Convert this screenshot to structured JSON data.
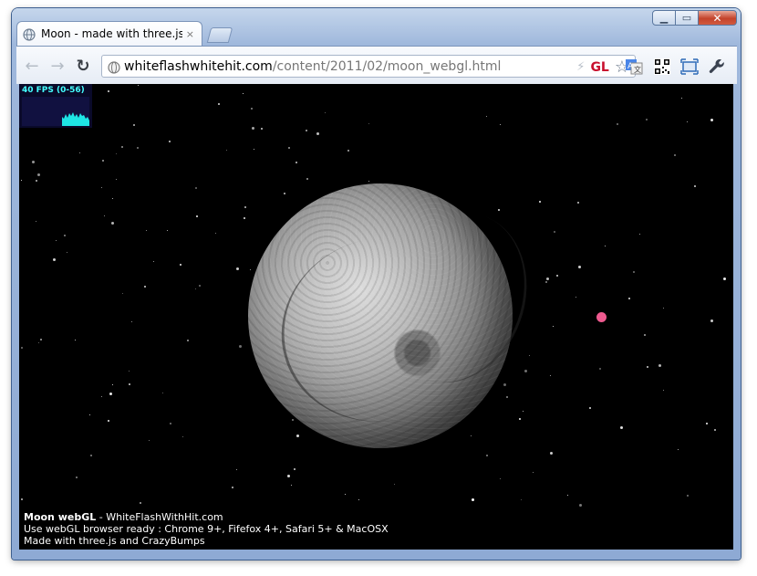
{
  "browser": {
    "tab_title": "Moon - made with three.js",
    "tab_close": "×",
    "url_host": "whiteflashwhitehit.com",
    "url_path": "/content/2011/02/moon_webgl.html",
    "gl_badge": "GL",
    "back_glyph": "←",
    "forward_glyph": "→",
    "reload_glyph": "↻",
    "star_glyph": "☆",
    "bolt_glyph": "⚡",
    "wrench_glyph": "🔧",
    "minimize_glyph": "▁",
    "maximize_glyph": "▭",
    "close_glyph": "✕"
  },
  "stats": {
    "fps_label": "40 FPS (0-56)"
  },
  "page": {
    "info_title": "Moon webGL",
    "info_title_suffix": " - WhiteFlashWithHit.com",
    "info_line2": "Use webGL browser ready : Chrome 9+, Fifefox 4+, Safari 5+ & MacOSX",
    "info_line3": "Made with three.js and CrazyBumps"
  },
  "colors": {
    "fps_text": "#44ffff",
    "pink_marker": "#ee5a8f",
    "gl_badge": "#c8102e"
  }
}
